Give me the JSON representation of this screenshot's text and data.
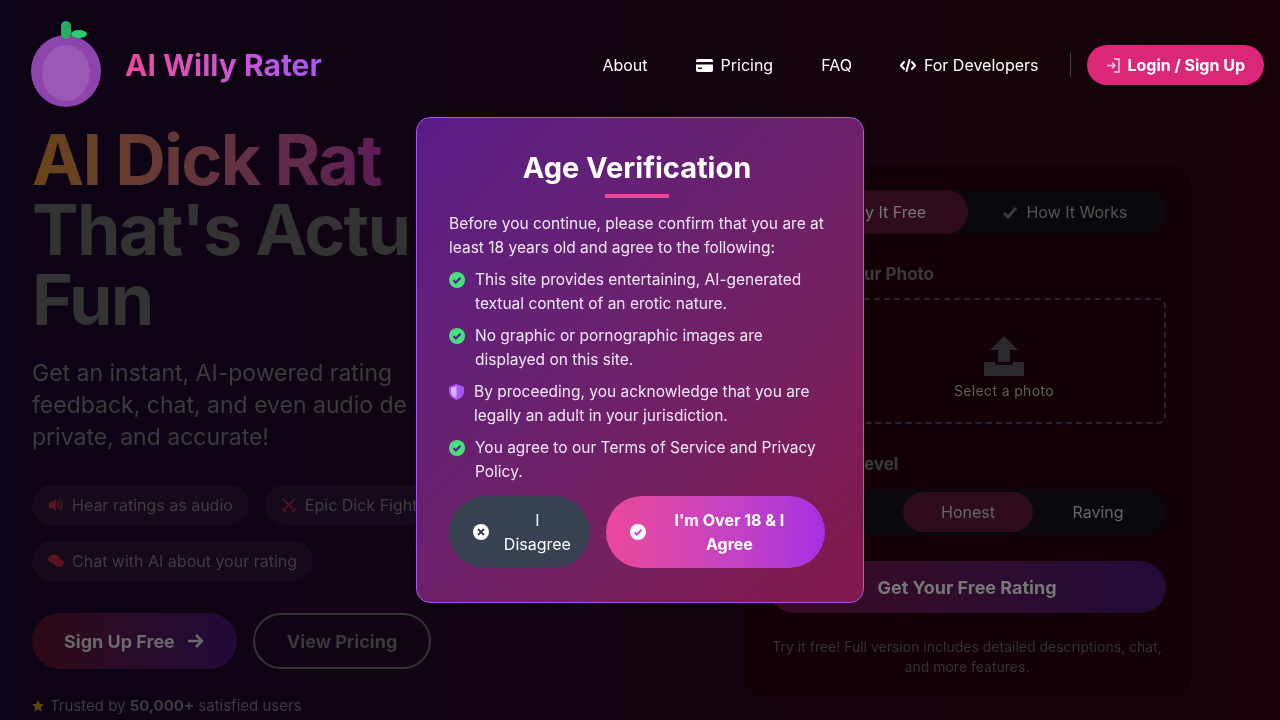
{
  "header": {
    "logo_title": "AI Willy Rater",
    "nav": [
      {
        "label": "About",
        "kind": "plain"
      },
      {
        "label": "Pricing",
        "kind": "card"
      },
      {
        "label": "FAQ",
        "kind": "plain"
      },
      {
        "label": "For Developers",
        "kind": "code"
      }
    ],
    "login_button": "Login / Sign Up"
  },
  "hero": {
    "title_lines": [
      {
        "text": "AI Dick Rat",
        "kind": "gradient"
      },
      {
        "text": "That's Actu",
        "kind": "plain"
      },
      {
        "text": "Fun",
        "kind": "plain"
      }
    ],
    "subtitle_lines": [
      "Get an instant, AI-powered rating",
      "feedback, chat, and even audio de",
      "private, and accurate!"
    ],
    "features": [
      {
        "label": "Hear ratings as audio",
        "kind": "speaker"
      },
      {
        "label": "Epic Dick Fight",
        "kind": "swords"
      },
      {
        "label": "Chat with AI about your rating",
        "kind": "chat"
      }
    ],
    "buttons": [
      {
        "label": "Sign Up Free",
        "kind": "primary"
      },
      {
        "label": "View Pricing",
        "kind": "outline"
      }
    ],
    "trust_text": "Trusted by **50,000+** satisfied users"
  },
  "card": {
    "tabs": [
      {
        "label": "y It Free",
        "selected": true
      },
      {
        "label": "How It Works",
        "selected": false
      }
    ],
    "upload_label": "ur Photo",
    "upload_hint": "Select a photo",
    "level_label": "evel",
    "levels": [
      {
        "label": "Honest",
        "selected": true
      },
      {
        "label": "Raving",
        "selected": false
      }
    ],
    "submit": "Get Your Free Rating",
    "footnote": "Try it free! Full version includes detailed descriptions, chat, and more features."
  },
  "modal": {
    "title": "Age Verification",
    "intro": "Before you continue, please confirm that you are at least 18 years old and agree to the following:",
    "items": [
      {
        "text": "This site provides entertaining, AI-generated textual content of an erotic nature.",
        "kind": "check"
      },
      {
        "text": "No graphic or pornographic images are displayed on this site.",
        "kind": "check"
      },
      {
        "text": "By proceeding, you acknowledge that you are legally an adult in your jurisdiction.",
        "kind": "shield"
      },
      {
        "text": "You agree to our Terms of Service and Privacy Policy.",
        "kind": "check"
      }
    ],
    "buttons": [
      {
        "label": "I Disagree",
        "kind": "secondary"
      },
      {
        "label": "I'm Over 18 & I Agree",
        "kind": "primary"
      }
    ]
  }
}
